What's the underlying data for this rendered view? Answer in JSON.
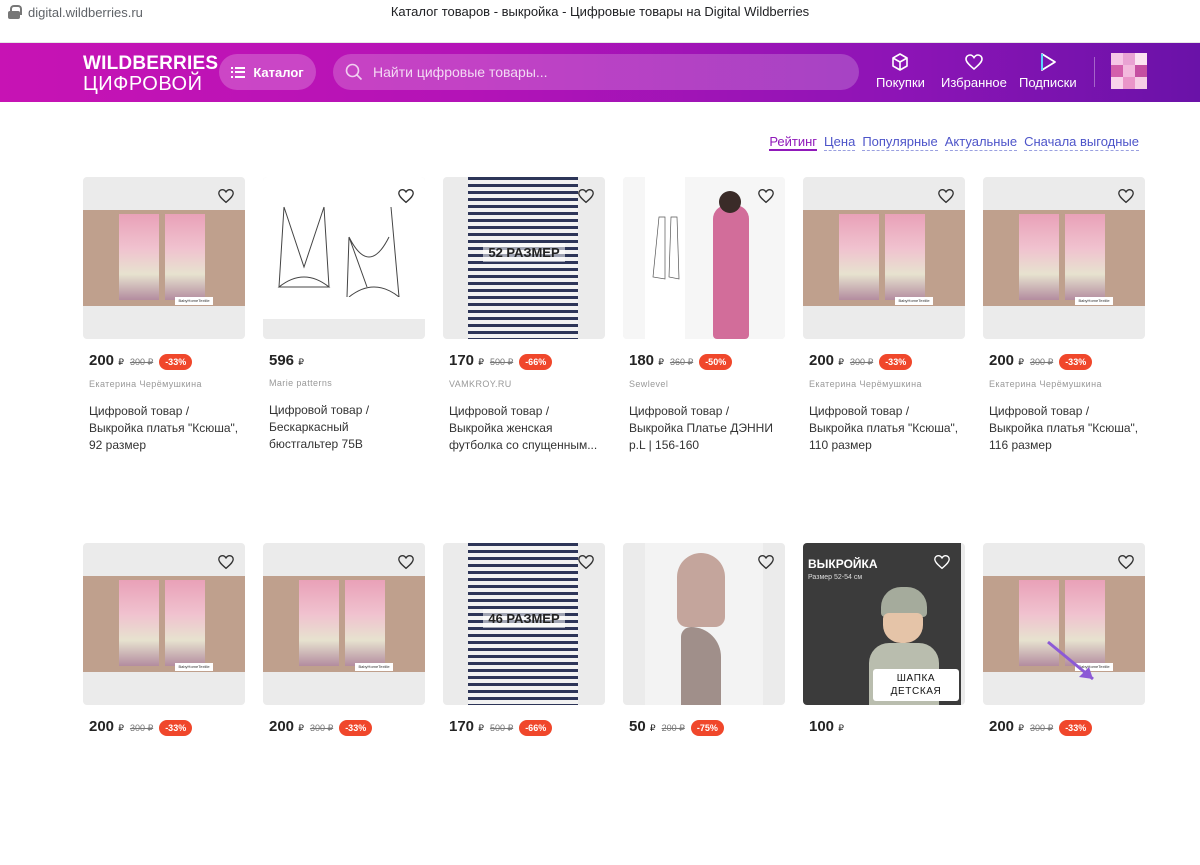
{
  "browser": {
    "url": "digital.wildberries.ru",
    "tab_title": "Каталог товаров - выкройка - Цифровые товары на Digital Wildberries"
  },
  "header": {
    "logo_line1": "WILDBERRIES",
    "logo_line2": "ЦИФРОВОЙ",
    "catalog_label": "Каталог",
    "search_placeholder": "Найти цифровые товары...",
    "nav": [
      {
        "label": "Покупки",
        "icon": "cube-icon"
      },
      {
        "label": "Избранное",
        "icon": "heart-icon"
      },
      {
        "label": "Подписки",
        "icon": "play-icon"
      }
    ],
    "accent": "#b313b7"
  },
  "sort": [
    "Рейтинг",
    "Цена",
    "Популярные",
    "Актуальные",
    "Сначала выгодные"
  ],
  "products": [
    {
      "price": "200",
      "old": "300 ₽",
      "disc": "-33%",
      "seller": "Екатерина Черёмушкина",
      "title": "Цифровой товар / Выкройка платья \"Ксюша\", 92 размер",
      "image": "dress-photo"
    },
    {
      "price": "596",
      "old": "",
      "disc": "",
      "seller": "Marie patterns",
      "title": "Цифровой товар / Бескаркасный бюстгальтер 75B",
      "image": "bra-sketch"
    },
    {
      "price": "170",
      "old": "500 ₽",
      "disc": "-66%",
      "seller": "VAMKROY.RU",
      "title": "Цифровой товар / Выкройка женская футболка со спущенным...",
      "image": "tshirt-photo",
      "img_text": "52 РАЗМЕР"
    },
    {
      "price": "180",
      "old": "360 ₽",
      "disc": "-50%",
      "seller": "Sewlevel",
      "title": "Цифровой товар / Выкройка Платье ДЭННИ p.L | 156-160",
      "image": "pink-dress-photo"
    },
    {
      "price": "200",
      "old": "300 ₽",
      "disc": "-33%",
      "seller": "Екатерина Черёмушкина",
      "title": "Цифровой товар / Выкройка платья \"Ксюша\", 110 размер",
      "image": "dress-photo"
    },
    {
      "price": "200",
      "old": "300 ₽",
      "disc": "-33%",
      "seller": "Екатерина Черёмушкина",
      "title": "Цифровой товар / Выкройка платья \"Ксюша\", 116 размер",
      "image": "dress-photo"
    },
    {
      "price": "200",
      "old": "300 ₽",
      "disc": "-33%",
      "seller": "",
      "title": "",
      "image": "dress-photo"
    },
    {
      "price": "200",
      "old": "300 ₽",
      "disc": "-33%",
      "seller": "",
      "title": "",
      "image": "dress-photo"
    },
    {
      "price": "170",
      "old": "500 ₽",
      "disc": "-66%",
      "seller": "",
      "title": "",
      "image": "tshirt-photo",
      "img_text": "46 РАЗМЕР"
    },
    {
      "price": "50",
      "old": "200 ₽",
      "disc": "-75%",
      "seller": "",
      "title": "",
      "image": "hood-photo"
    },
    {
      "price": "100",
      "old": "",
      "disc": "",
      "seller": "",
      "title": "",
      "image": "hat-photo",
      "img_title": "ВЫКРОЙКА",
      "img_sub": "Размер 52-54 см",
      "img_label": "ШАПКА ДЕТСКАЯ"
    },
    {
      "price": "200",
      "old": "300 ₽",
      "disc": "-33%",
      "seller": "",
      "title": "",
      "image": "dress-photo"
    }
  ],
  "currency": "₽"
}
